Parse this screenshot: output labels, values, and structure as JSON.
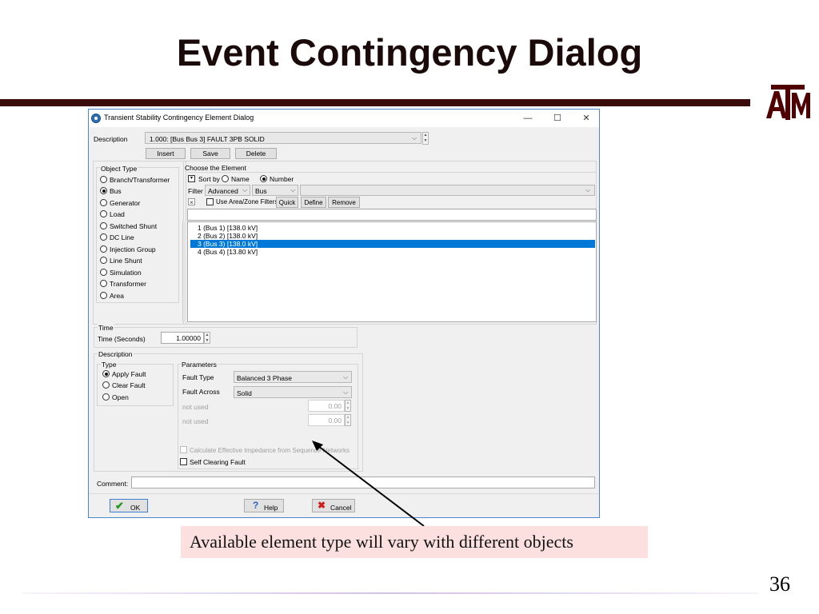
{
  "slide": {
    "title": "Event Contingency Dialog",
    "page_number": "36",
    "callout": "Available element type will vary with different objects",
    "logo_text": "ATM"
  },
  "dialog": {
    "title": "Transient Stability Contingency Element Dialog",
    "window_controls": {
      "minimize": "—",
      "maximize": "☐",
      "close": "✕"
    },
    "description_label": "Description",
    "description_value": "1.000: [Bus Bus 3] FAULT 3PB SOLID",
    "buttons": {
      "insert": "Insert",
      "save": "Save",
      "delete": "Delete"
    },
    "object_type": {
      "label": "Object Type",
      "selected": "Bus",
      "options": [
        "Branch/Transformer",
        "Bus",
        "Generator",
        "Load",
        "Switched Shunt",
        "DC Line",
        "Injection Group",
        "Line Shunt",
        "Simulation",
        "Transformer",
        "Area"
      ]
    },
    "choose_element": {
      "label": "Choose the Element",
      "sort_by_label": "Sort by",
      "sort_name": "Name",
      "sort_number": "Number",
      "sort_selected": "Number",
      "filter_label": "Filter",
      "filter_mode": "Advanced",
      "filter_object": "Bus",
      "filter_value": "",
      "use_area_zone": "Use Area/Zone Filters",
      "quick": "Quick",
      "define": "Define",
      "remove": "Remove",
      "search_value": "",
      "items": [
        "1 (Bus 1)  [138.0 kV]",
        "2 (Bus 2)  [138.0 kV]",
        "3 (Bus 3)  [138.0 kV]",
        "4 (Bus 4)  [13.80 kV]"
      ],
      "selected_index": 2
    },
    "time": {
      "group_label": "Time",
      "label": "Time (Seconds)",
      "value": "1.00000"
    },
    "description_group": {
      "label": "Description",
      "type_label": "Type",
      "types": [
        "Apply Fault",
        "Clear Fault",
        "Open"
      ],
      "type_selected": "Apply Fault",
      "parameters_label": "Parameters",
      "fault_type_label": "Fault Type",
      "fault_type_value": "Balanced 3 Phase",
      "fault_across_label": "Fault Across",
      "fault_across_value": "Solid",
      "not_used_1_label": "not used",
      "not_used_1_value": "0.00",
      "not_used_2_label": "not used",
      "not_used_2_value": "0.00",
      "calc_impedance": "Calculate Effective Impedance from Sequence Networks",
      "self_clearing": "Self Clearing Fault"
    },
    "comment_label": "Comment:",
    "comment_value": "",
    "ok": "OK",
    "help": "Help",
    "cancel": "Cancel"
  },
  "colors": {
    "title_rule": "#3b0a0a",
    "selection": "#0078d7",
    "callout_bg": "#fce0e0",
    "brand_maroon": "#500000"
  }
}
